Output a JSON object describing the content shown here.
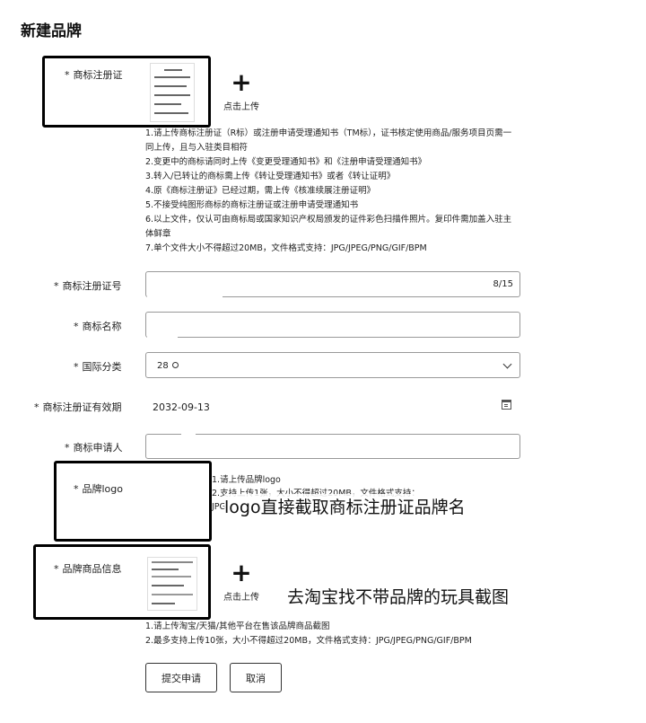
{
  "page": {
    "title": "新建品牌"
  },
  "trademark_certificate": {
    "label": "商标注册证",
    "upload_text": "点击上传",
    "notes": [
      "1.请上传商标注册证（R标）或注册申请受理通知书（TM标），证书核定使用商品/服务项目页需一",
      "同上传，且与入驻类目相符",
      "2.变更中的商标请同时上传《变更受理通知书》和《注册申请受理通知书》",
      "3.转入/已转让的商标需上传《转让受理通知书》或者《转让证明》",
      "4.原《商标注册证》已经过期，需上传《核准续展注册证明》",
      "5.不接受纯图形商标的商标注册证或注册申请受理通知书",
      "6.以上文件，仅认可由商标局或国家知识产权局颁发的证件彩色扫描件照片。复印件需加盖入驻主",
      "体鲜章",
      "7.单个文件大小不得超过20MB，文件格式支持：JPG/JPEG/PNG/GIF/BPM"
    ]
  },
  "fields": {
    "reg_number": {
      "label": "商标注册证号",
      "counter": "8/15"
    },
    "brand_name": {
      "label": "商标名称"
    },
    "intl_class": {
      "label": "国际分类",
      "value": "28"
    },
    "validity": {
      "label": "商标注册证有效期",
      "value": "2032-09-13"
    },
    "applicant": {
      "label": "商标申请人"
    }
  },
  "brand_logo": {
    "label": "品牌logo",
    "notes": [
      "1.请上传品牌logo",
      "2.支持上传1张，大小不得超过20MB，文件格式支持：",
      "JPG"
    ],
    "annotation": "logo直接截取商标注册证品牌名"
  },
  "brand_product": {
    "label": "品牌商品信息",
    "upload_text": "点击上传",
    "annotation": "去淘宝找不带品牌的玩具截图",
    "notes": [
      "1.请上传淘宝/天猫/其他平台在售该品牌商品截图",
      "2.最多支持上传10张，大小不得超过20MB，文件格式支持：JPG/JPEG/PNG/GIF/BPM"
    ]
  },
  "actions": {
    "submit": "提交申请",
    "cancel": "取消"
  },
  "required_mark": "*"
}
